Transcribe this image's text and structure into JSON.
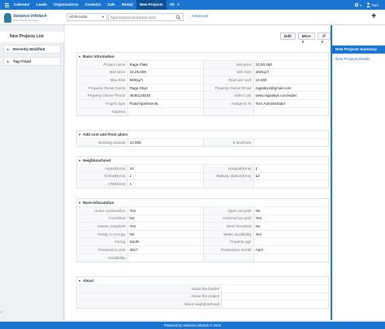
{
  "topnav": {
    "items": [
      "Calendar",
      "Leads",
      "Organizations",
      "Contacts",
      "Sale",
      "Rental",
      "New Projects",
      "All"
    ],
    "active_index": 6,
    "user": "Tom"
  },
  "header": {
    "logo_line1": "Variance Infotech",
    "logo_line2": "grow through innovation",
    "records_filter": "All Records",
    "search_placeholder": "Type keyword and press enter",
    "advanced_label": "Advanced"
  },
  "left": {
    "title": "New Projects List",
    "accordions": [
      "Recently Modified",
      "Tag Cloud"
    ]
  },
  "toolbar": {
    "edit": "Edit",
    "more": "More"
  },
  "sections": {
    "basic": {
      "title": "Basic information",
      "rows": [
        [
          "Project name",
          "Raga Flats",
          "Min price",
          "10,00,450"
        ],
        [
          "Max price",
          "15,25,000",
          "Min Size",
          "300sq.ft"
        ],
        [
          "Max Size",
          "500sq.ft",
          "Rate per sq.ft",
          "10,000"
        ],
        [
          "Property Owner Name",
          "Raga Skys",
          "Property Owner Email",
          "ragaskys@gmail.com"
        ],
        [
          "Property Owner Phone",
          "4645124545",
          "Video Link",
          "www.ragaskys.com/videc"
        ],
        [
          "Project type",
          "Flats/Apartments",
          "Assigned To",
          "Tom Administrator"
        ],
        [
          "Address",
          "",
          "",
          ""
        ]
      ]
    },
    "cost": {
      "title": "Add cost and Floor plans",
      "rows": [
        [
          "Booking amount",
          "10,000",
          "E-brochure",
          ""
        ]
      ]
    },
    "neighbourhood": {
      "title": "Neighbourhood",
      "rows": [
        [
          "Airport(Kms)",
          "10",
          "Hospital(Kms)",
          "1"
        ],
        [
          "School(Kms)",
          "1",
          "Railway station(Kms)",
          "12"
        ],
        [
          "ATM(Kms)",
          "1",
          "",
          ""
        ]
      ]
    },
    "more": {
      "title": "More Infocamtion",
      "rows": [
        [
          "Under construction",
          "Yes",
          "Open car park",
          "No"
        ],
        [
          "Furnished",
          "No",
          "Covered car park",
          "Yes"
        ],
        [
          "Vaastu compliant",
          "Yes",
          "Semi furnished",
          "No"
        ],
        [
          "Ready to occupy",
          "No",
          "Water availability",
          "Yes"
        ],
        [
          "Facing",
          "South",
          "Property age",
          ""
        ],
        [
          "Possession year",
          "2017",
          "Possession month",
          "April"
        ],
        [
          "Availability",
          "",
          "",
          ""
        ]
      ]
    },
    "about": {
      "title": "About",
      "rows": [
        [
          "About the builder",
          ""
        ],
        [
          "About the project",
          ""
        ],
        [
          "About neighbourhood",
          ""
        ]
      ]
    }
  },
  "right": {
    "active": "New Projects Summary",
    "item": "New Projects Details"
  },
  "footer": "Powered by Variance Infotech  © 2016"
}
